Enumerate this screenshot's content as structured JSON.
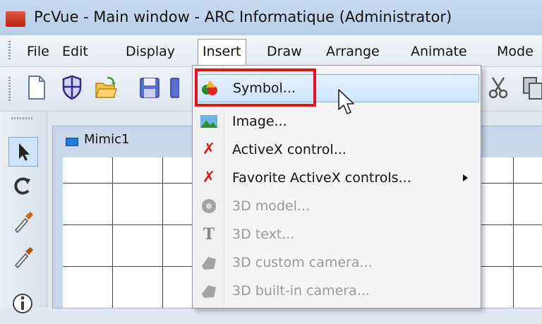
{
  "window": {
    "title": "PcVue - Main window - ARC Informatique (Administrator)"
  },
  "menubar": {
    "items": [
      {
        "label": "File"
      },
      {
        "label": "Edit"
      },
      {
        "label": "Display"
      },
      {
        "label": "Insert",
        "open": true
      },
      {
        "label": "Draw"
      },
      {
        "label": "Arrange"
      },
      {
        "label": "Animate"
      },
      {
        "label": "Mode"
      }
    ]
  },
  "toolbar": {
    "icons": [
      "new-document-icon",
      "shield-icon",
      "open-folder-icon",
      "save-icon",
      "save-all-icon",
      "cut-icon",
      "copy-icon"
    ]
  },
  "lefttools": {
    "icons": [
      "select-arrow-icon",
      "rotate-icon",
      "pipette-icon",
      "pipette-alt-icon",
      "info-icon"
    ]
  },
  "mimic": {
    "title": "Mimic1"
  },
  "insert_menu": {
    "items": [
      {
        "label": "Symbol...",
        "icon": "symbol-icon",
        "state": "hover"
      },
      {
        "label": "Image...",
        "icon": "image-icon",
        "state": "enabled"
      },
      {
        "label": "ActiveX control...",
        "icon": "activex-icon",
        "state": "enabled"
      },
      {
        "label": "Favorite ActiveX controls...",
        "icon": "activex-favorite-icon",
        "state": "enabled",
        "submenu": true
      },
      {
        "label": "3D model...",
        "icon": "3d-model-icon",
        "state": "disabled"
      },
      {
        "label": "3D text...",
        "icon": "3d-text-icon",
        "state": "disabled"
      },
      {
        "label": "3D custom camera...",
        "icon": "camera-icon",
        "state": "disabled"
      },
      {
        "label": "3D built-in camera...",
        "icon": "camera-builtin-icon",
        "state": "disabled"
      }
    ]
  },
  "colors": {
    "highlight": "#e4141c",
    "hover": "#cfe5fd"
  }
}
